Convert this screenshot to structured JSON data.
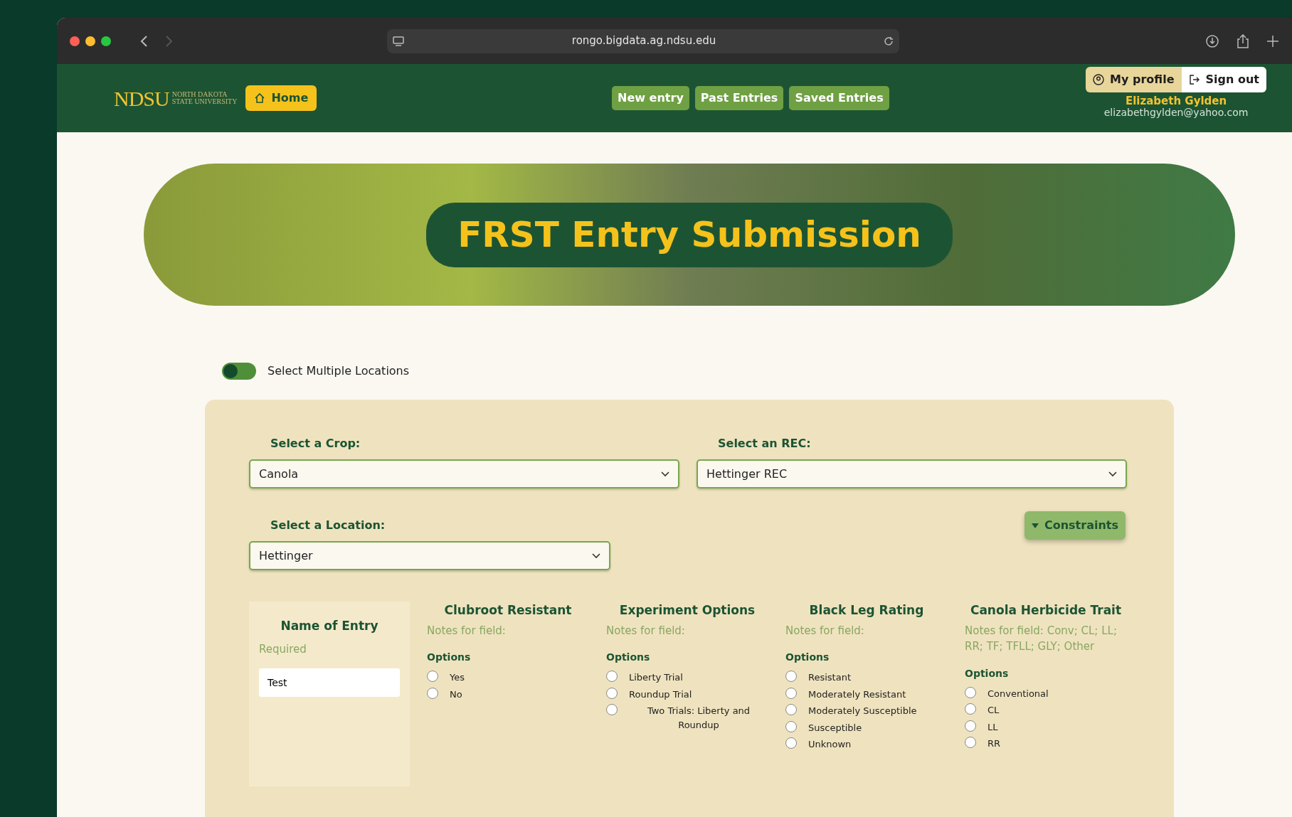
{
  "browser": {
    "url": "rongo.bigdata.ag.ndsu.edu"
  },
  "navbar": {
    "logo_mark": "NDSU",
    "logo_lines": [
      "NORTH DAKOTA",
      "STATE UNIVERSITY"
    ],
    "home": "Home",
    "links": [
      {
        "label": "New entry"
      },
      {
        "label": "Past Entries"
      },
      {
        "label": "Saved Entries"
      }
    ],
    "profile": "My profile",
    "sign_out": "Sign out",
    "user_name": "Elizabeth Gylden",
    "user_email": "elizabethgylden@yahoo.com"
  },
  "banner": {
    "title": "FRST Entry Submission"
  },
  "multi_location": {
    "label": "Select Multiple Locations",
    "on": false
  },
  "form": {
    "crop": {
      "label": "Select a Crop:",
      "value": "Canola"
    },
    "rec": {
      "label": "Select an REC:",
      "value": "Hettinger REC"
    },
    "location": {
      "label": "Select a Location:",
      "value": "Hettinger"
    },
    "constraints": "Constraints"
  },
  "name_of_entry": {
    "title": "Name of Entry",
    "note": "Required",
    "value": "Test"
  },
  "fields": [
    {
      "title": "Clubroot Resistant",
      "notes": "Notes for field:",
      "options_label": "Options",
      "options": [
        {
          "label": "Yes",
          "selected": false
        },
        {
          "label": "No",
          "selected": false
        }
      ]
    },
    {
      "title": "Experiment Options",
      "notes": "Notes for field:",
      "options_label": "Options",
      "options": [
        {
          "label": "Liberty Trial",
          "selected": false
        },
        {
          "label": "Roundup Trial",
          "selected": false
        },
        {
          "label": "Two Trials: Liberty and Roundup",
          "selected": false
        }
      ]
    },
    {
      "title": "Black Leg Rating",
      "notes": "Notes for field:",
      "options_label": "Options",
      "options": [
        {
          "label": "Resistant",
          "selected": false
        },
        {
          "label": "Moderately Resistant",
          "selected": false
        },
        {
          "label": "Moderately Susceptible",
          "selected": false
        },
        {
          "label": "Susceptible",
          "selected": false
        },
        {
          "label": "Unknown",
          "selected": false
        }
      ]
    },
    {
      "title": "Canola Herbicide Trait",
      "notes": "Notes for field: Conv; CL; LL; RR; TF; TFLL; GLY; Other",
      "options_label": "Options",
      "options": [
        {
          "label": "Conventional",
          "selected": false
        },
        {
          "label": "CL",
          "selected": false
        },
        {
          "label": "LL",
          "selected": false
        },
        {
          "label": "RR",
          "selected": false
        }
      ]
    }
  ]
}
